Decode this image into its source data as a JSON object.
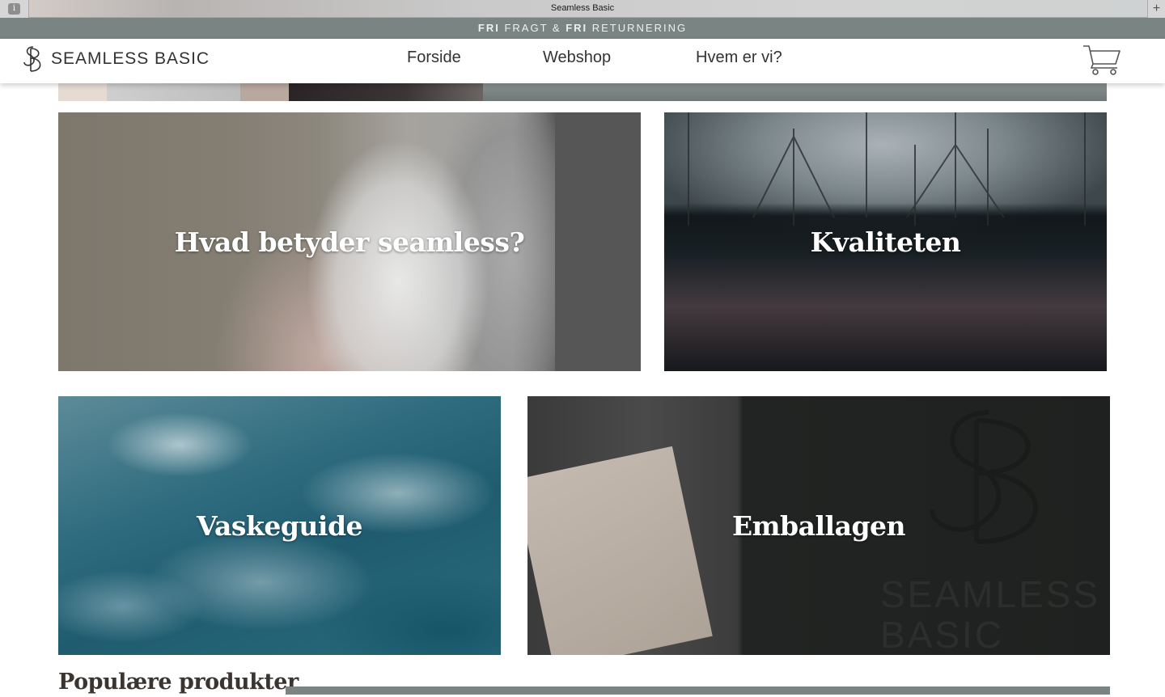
{
  "browser": {
    "title": "Seamless Basic",
    "info_glyph": "i",
    "new_tab_glyph": "+"
  },
  "promo": {
    "word1": "FRI",
    "text1": " FRAGT & ",
    "word2": "FRI",
    "text2": " RETURNERING"
  },
  "brand": {
    "name": "SEAMLESS BASIC",
    "monogram": "SB"
  },
  "nav": {
    "items": [
      "Forside",
      "Webshop",
      "Hvem er vi?"
    ]
  },
  "tiles": [
    {
      "title": "Hvad betyder seamless?"
    },
    {
      "title": "Kvaliteten"
    },
    {
      "title": "Vaskeguide"
    },
    {
      "title": "Emballagen"
    }
  ],
  "packaging_print": {
    "line1": "SEAMLESS",
    "line2": "BASIC"
  },
  "section": {
    "title": "Populære produkter"
  },
  "colors": {
    "accent_grey": "#7a8482",
    "text_dark": "#333333"
  },
  "icons": {
    "cart": "shopping-cart-icon",
    "info": "info-icon",
    "plus": "new-tab-icon"
  }
}
